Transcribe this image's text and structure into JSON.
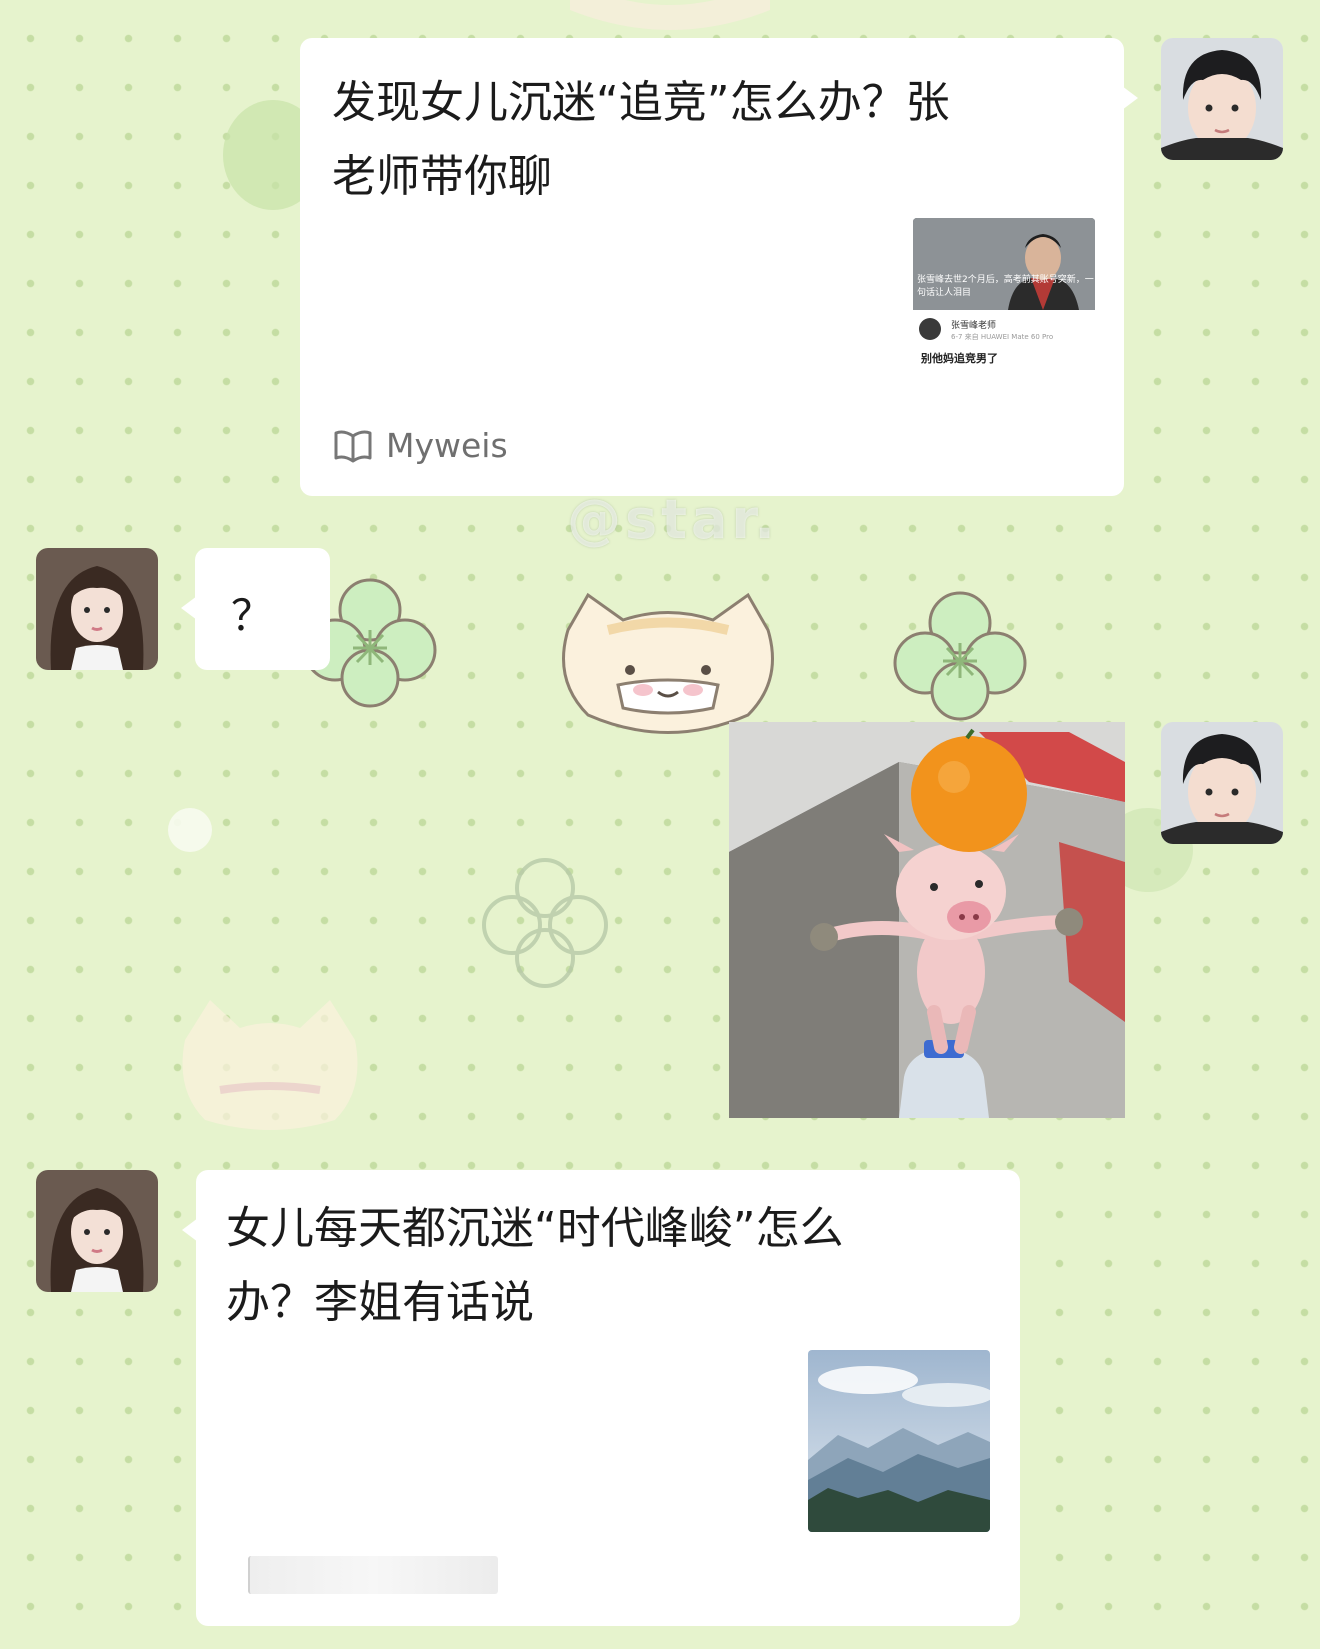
{
  "chat": {
    "watermark": "@star.",
    "messages": [
      {
        "sender": "me",
        "type": "link-card",
        "title": "发现女儿沉迷“追竞”怎么办？张老师带你聊",
        "title_line1": "发现女儿沉迷“追竞”怎么办？张",
        "title_line2": "老师带你聊",
        "source": "Myweis",
        "thumbnail": {
          "overlay_text": "张雪峰去世2个月后，高考前其账号突新，一句话让人泪目",
          "account_name": "张雪峰老师",
          "device": "6-7  来自 HUAWEI Mate 60 Pro",
          "post_text": "别他妈追竞男了"
        }
      },
      {
        "sender": "friend",
        "type": "text",
        "text": "？"
      },
      {
        "sender": "me",
        "type": "image",
        "image_icon": "pig-balancing-orange-icon"
      },
      {
        "sender": "friend",
        "type": "link-card",
        "title": "女儿每天都沉迷“时代峰峻”怎么办？李姐有话说",
        "title_line1": "女儿每天都沉迷“时代峰峻”怎么",
        "title_line2": "办？李姐有话说",
        "thumbnail_icon": "mountain-landscape-icon"
      }
    ]
  },
  "colors": {
    "background": "#e6f3cd",
    "bubble": "#ffffff",
    "text": "#1b1b1b",
    "source_text": "#6f6f6f"
  }
}
